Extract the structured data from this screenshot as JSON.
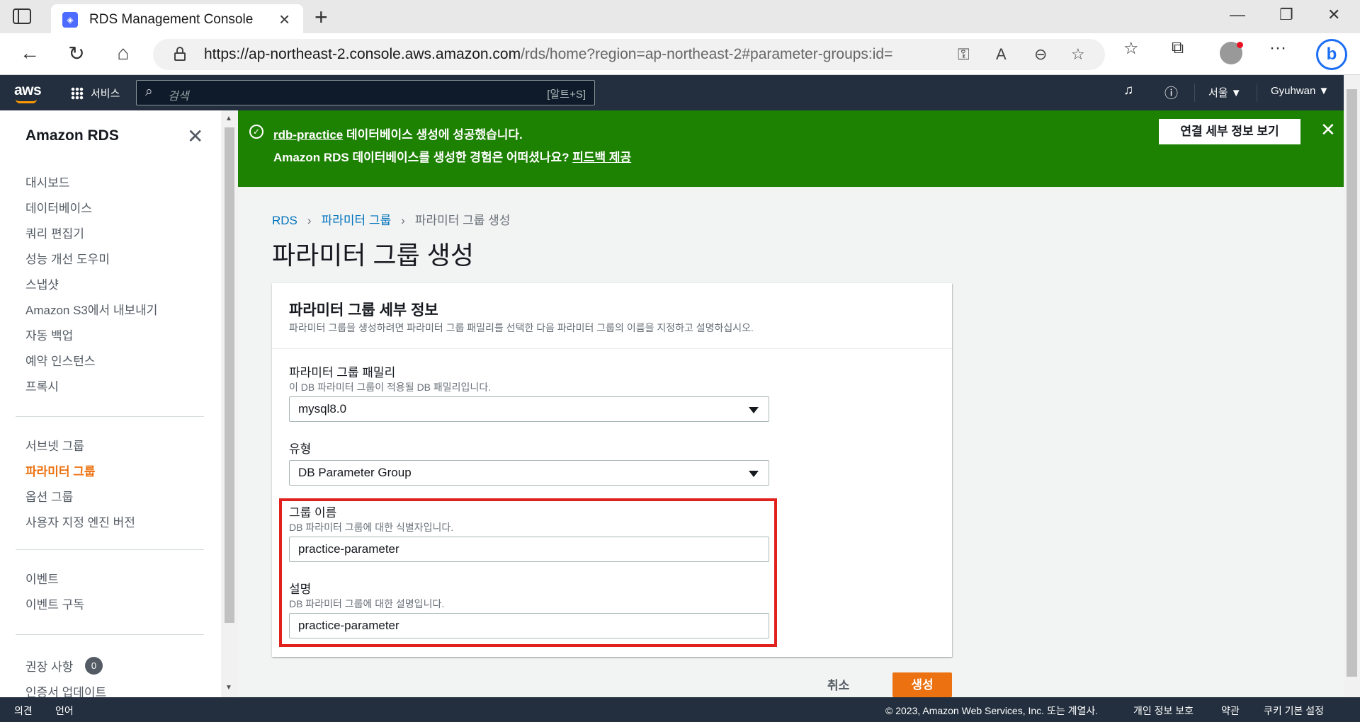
{
  "browser": {
    "tab_title": "RDS Management Console",
    "url_host": "https://ap-northeast-2.console.aws.amazon.com",
    "url_path": "/rds/home?region=ap-northeast-2#parameter-groups:id="
  },
  "awsnav": {
    "logo": "aws",
    "services": "서비스",
    "search_placeholder": "검색",
    "search_shortcut": "[알트+S]",
    "region": "서울 ▼",
    "user": "Gyuhwan ▼"
  },
  "sidebar": {
    "title": "Amazon RDS",
    "items": [
      {
        "label": "대시보드"
      },
      {
        "label": "데이터베이스"
      },
      {
        "label": "쿼리 편집기"
      },
      {
        "label": "성능 개선 도우미"
      },
      {
        "label": "스냅샷"
      },
      {
        "label": "Amazon S3에서 내보내기"
      },
      {
        "label": "자동 백업"
      },
      {
        "label": "예약 인스턴스"
      },
      {
        "label": "프록시"
      },
      {
        "label": "서브넷 그룹"
      },
      {
        "label": "파라미터 그룹"
      },
      {
        "label": "옵션 그룹"
      },
      {
        "label": "사용자 지정 엔진 버전"
      },
      {
        "label": "이벤트"
      },
      {
        "label": "이벤트 구독"
      },
      {
        "label": "권장 사항"
      },
      {
        "label": "인증서 업데이트"
      }
    ],
    "active_item": "파라미터 그룹",
    "recommendations_badge": "0"
  },
  "flash": {
    "db_name": "rdb-practice",
    "line1_suffix": " 데이터베이스 생성에 성공했습니다.",
    "line2_prefix": "Amazon RDS 데이터베이스를 생성한 경험은 어떠셨나요? ",
    "feedback_link": "피드백 제공",
    "button": "연결 세부 정보 보기",
    "status_color": "#1d8102"
  },
  "breadcrumb": {
    "root": "RDS",
    "parent": "파라미터 그룹",
    "current": "파라미터 그룹 생성"
  },
  "page_title": "파라미터 그룹 생성",
  "panel": {
    "title": "파라미터 그룹 세부 정보",
    "description": "파라미터 그룹을 생성하려면 파라미터 그룹 패밀리를 선택한 다음 파라미터 그룹의 이름을 지정하고 설명하십시오.",
    "family": {
      "label": "파라미터 그룹 패밀리",
      "desc": "이 DB 파라미터 그룹이 적용될 DB 패밀리입니다.",
      "value": "mysql8.0"
    },
    "type": {
      "label": "유형",
      "value": "DB Parameter Group"
    },
    "group_name": {
      "label": "그룹 이름",
      "desc": "DB 파라미터 그룹에 대한 식별자입니다.",
      "value": "practice-parameter"
    },
    "description_field": {
      "label": "설명",
      "desc": "DB 파라미터 그룹에 대한 설명입니다.",
      "value": "practice-parameter"
    }
  },
  "actions": {
    "cancel": "취소",
    "create": "생성",
    "primary_color": "#ec7211"
  },
  "footer": {
    "feedback": "의견",
    "language": "언어",
    "copyright": "© 2023, Amazon Web Services, Inc. 또는 계열사.",
    "privacy": "개인 정보 보호",
    "terms": "약관",
    "cookies": "쿠키 기본 설정"
  }
}
